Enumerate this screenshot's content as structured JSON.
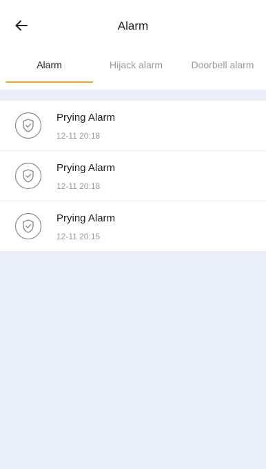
{
  "header": {
    "title": "Alarm",
    "back_icon": "arrow-left-icon"
  },
  "tabs": [
    {
      "label": "Alarm",
      "active": true
    },
    {
      "label": "Hijack alarm",
      "active": false
    },
    {
      "label": "Doorbell alarm",
      "active": false
    }
  ],
  "accent_color": "#f0a81c",
  "alarms": [
    {
      "name": "Prying Alarm",
      "time": "12-11 20:18",
      "icon": "shield-check-icon"
    },
    {
      "name": "Prying Alarm",
      "time": "12-11 20:18",
      "icon": "shield-check-icon"
    },
    {
      "name": "Prying Alarm",
      "time": "12-11 20:15",
      "icon": "shield-check-icon"
    }
  ]
}
